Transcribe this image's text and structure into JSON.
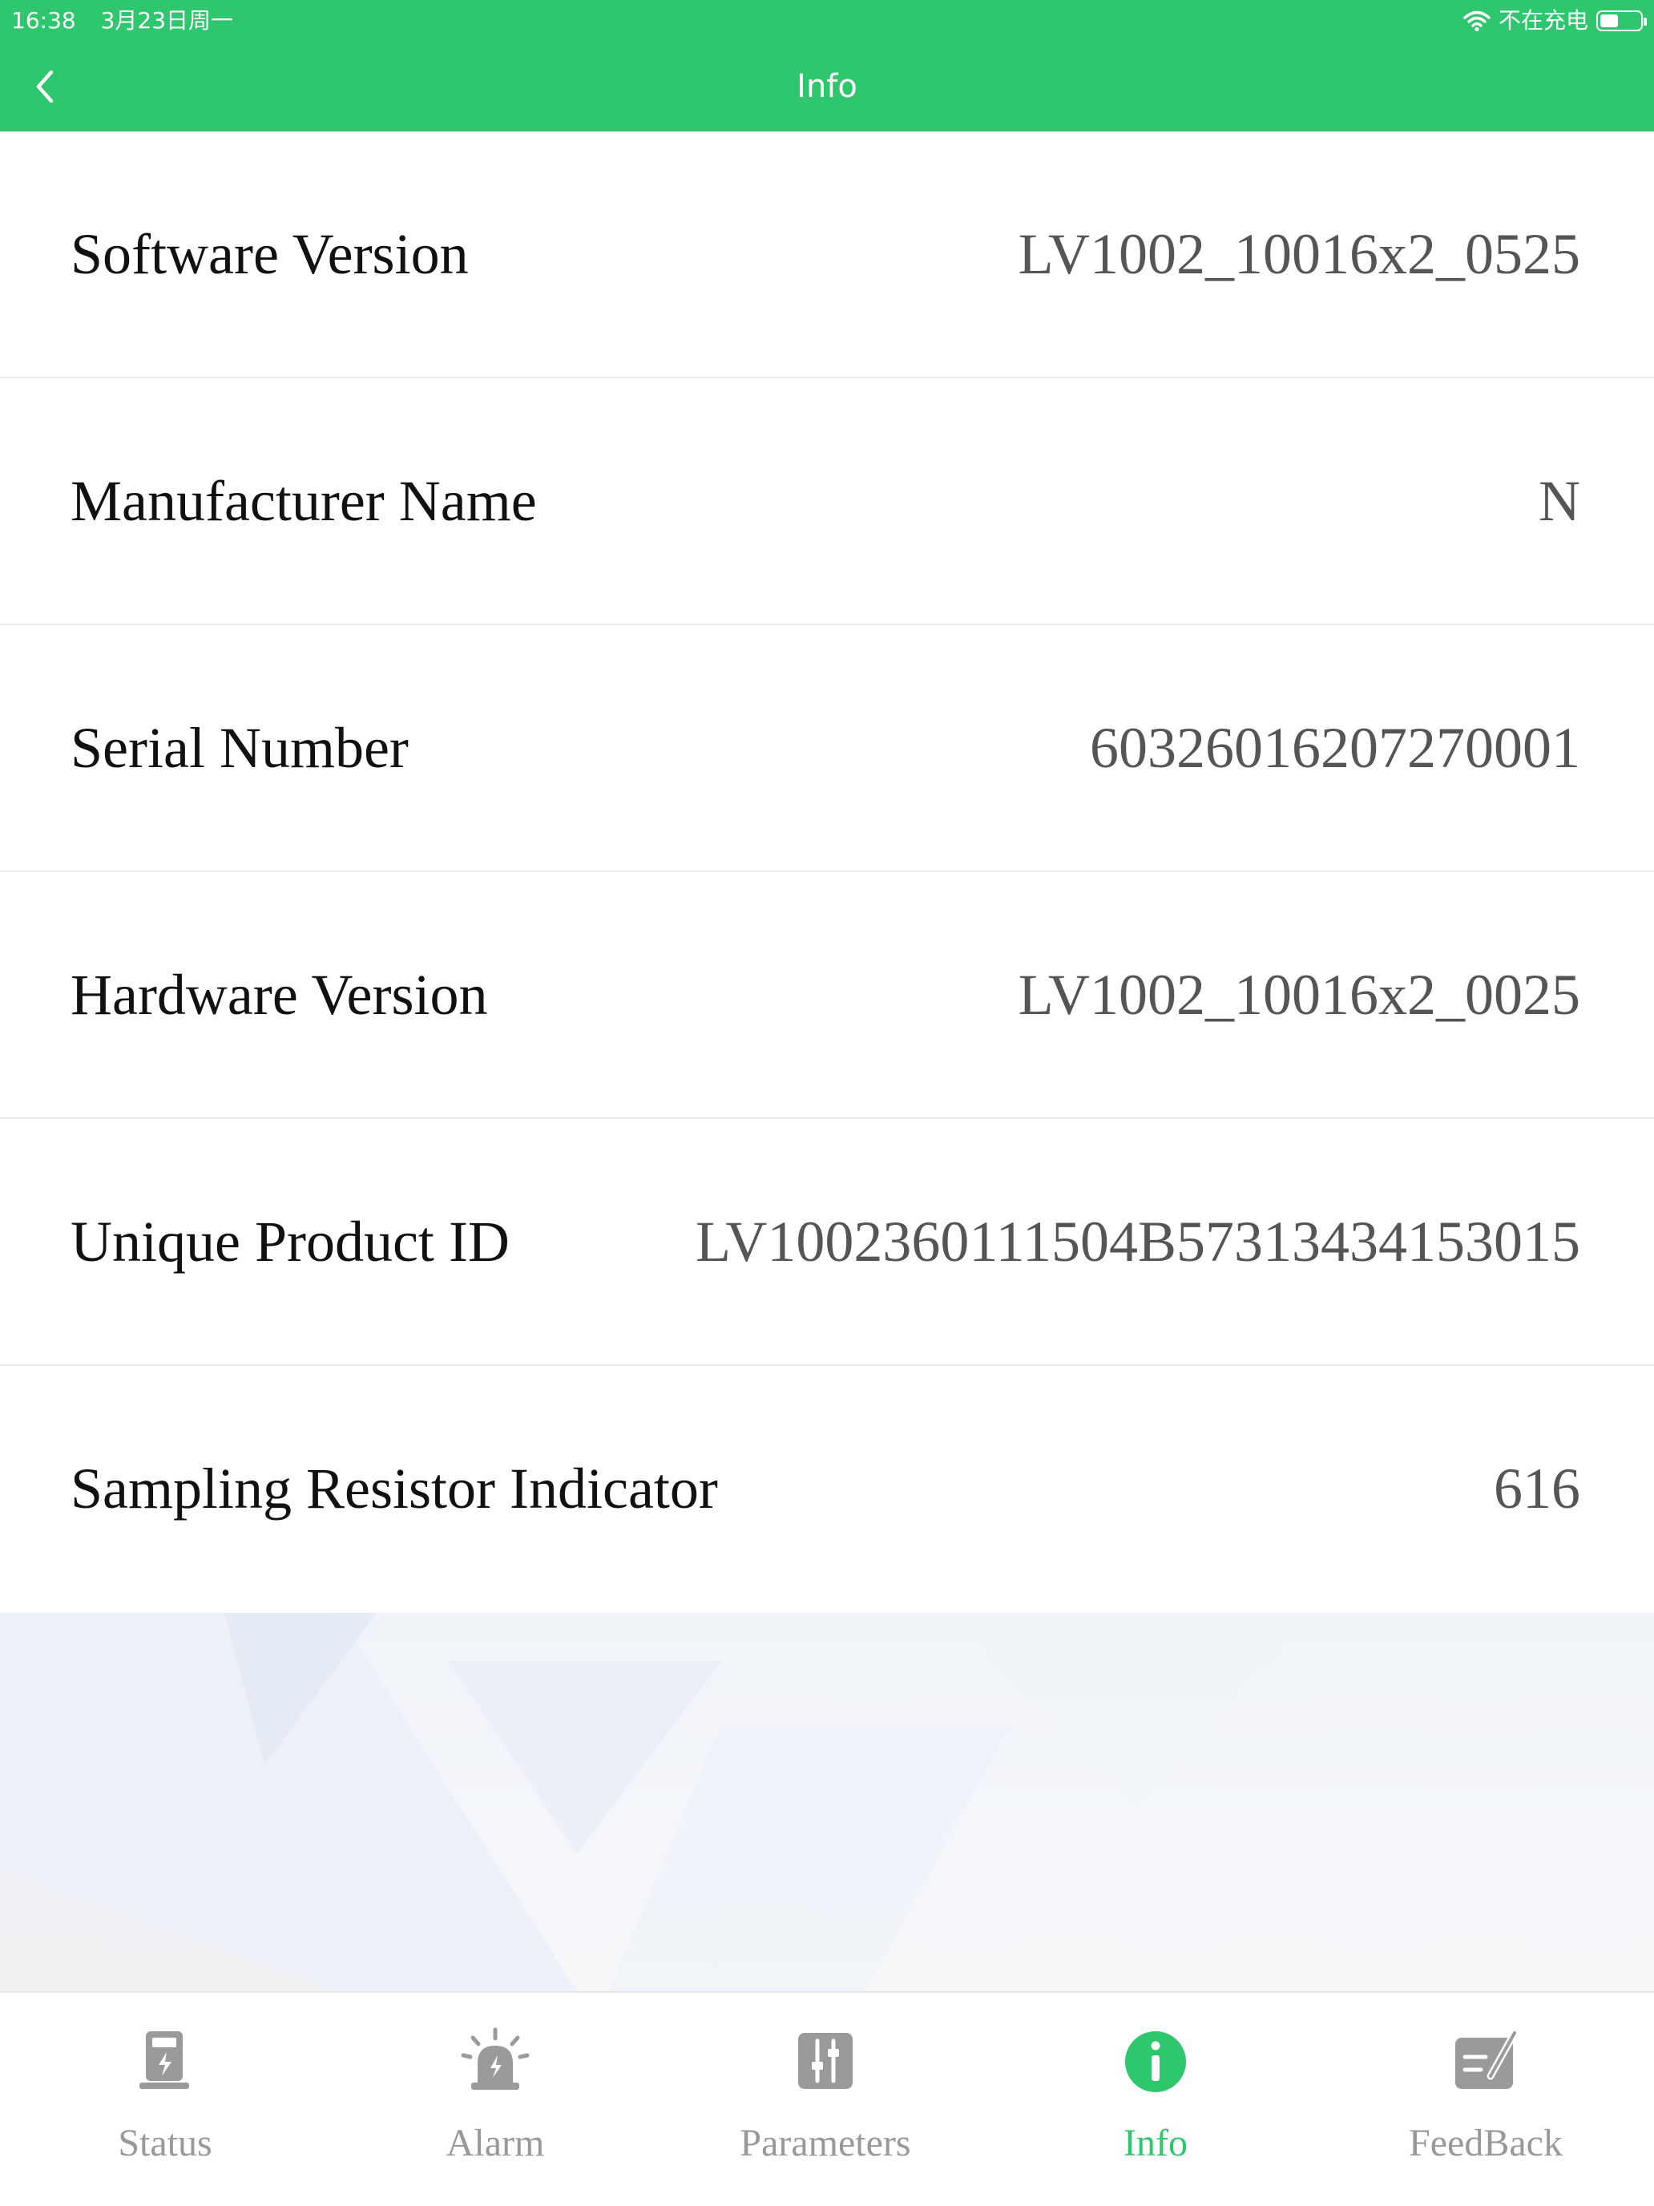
{
  "status_bar": {
    "time": "16:38",
    "date": "3月23日周一",
    "charging": "不在充电"
  },
  "nav": {
    "title": "Info"
  },
  "info_rows": [
    {
      "label": "Software Version",
      "value": "LV1002_10016x2_0525"
    },
    {
      "label": "Manufacturer Name",
      "value": "N"
    },
    {
      "label": "Serial Number",
      "value": "60326016207270001"
    },
    {
      "label": "Hardware Version",
      "value": "LV1002_10016x2_0025"
    },
    {
      "label": "Unique Product ID",
      "value": "LV1002360111504B57313434153015"
    },
    {
      "label": "Sampling Resistor Indicator",
      "value": "616"
    }
  ],
  "tabs": [
    {
      "label": "Status",
      "icon": "charger-icon"
    },
    {
      "label": "Alarm",
      "icon": "siren-icon"
    },
    {
      "label": "Parameters",
      "icon": "sliders-icon"
    },
    {
      "label": "Info",
      "icon": "info-icon"
    },
    {
      "label": "FeedBack",
      "icon": "edit-icon"
    }
  ],
  "active_tab": "Info",
  "colors": {
    "accent": "#2ec76d",
    "inactive": "#999999",
    "label_text": "#111111",
    "value_text": "#555555"
  }
}
